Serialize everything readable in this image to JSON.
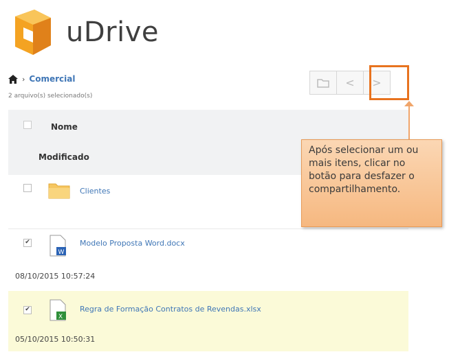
{
  "app": {
    "brand": "uDrive"
  },
  "breadcrumb": {
    "folder": "Comercial"
  },
  "selection": {
    "count_text": "2 arquivo(s) selecionado(s)"
  },
  "table": {
    "header": {
      "name": "Nome",
      "modified": "Modificado"
    },
    "rows": [
      {
        "name": "Clientes",
        "type": "folder-icon",
        "checked": false,
        "date": ""
      },
      {
        "name": "Modelo Proposta Word.docx",
        "type": "word-file-icon",
        "checked": true,
        "date": "08/10/2015 10:57:24"
      },
      {
        "name": "Regra de Formação Contratos de Revendas.xlsx",
        "type": "excel-file-icon",
        "checked": true,
        "date": "05/10/2015 10:50:31"
      }
    ]
  },
  "toolbar": {
    "icons": [
      "folder-icon",
      "share-icon",
      "unshare-icon"
    ]
  },
  "callout": {
    "text": "Após selecionar um ou mais itens, clicar no botão para desfazer o compartilhamento."
  },
  "colors": {
    "accent": "#e8731f",
    "link": "#3f76b6",
    "row_selected": "#fbfad8",
    "callout_bg": "#f6b880"
  }
}
